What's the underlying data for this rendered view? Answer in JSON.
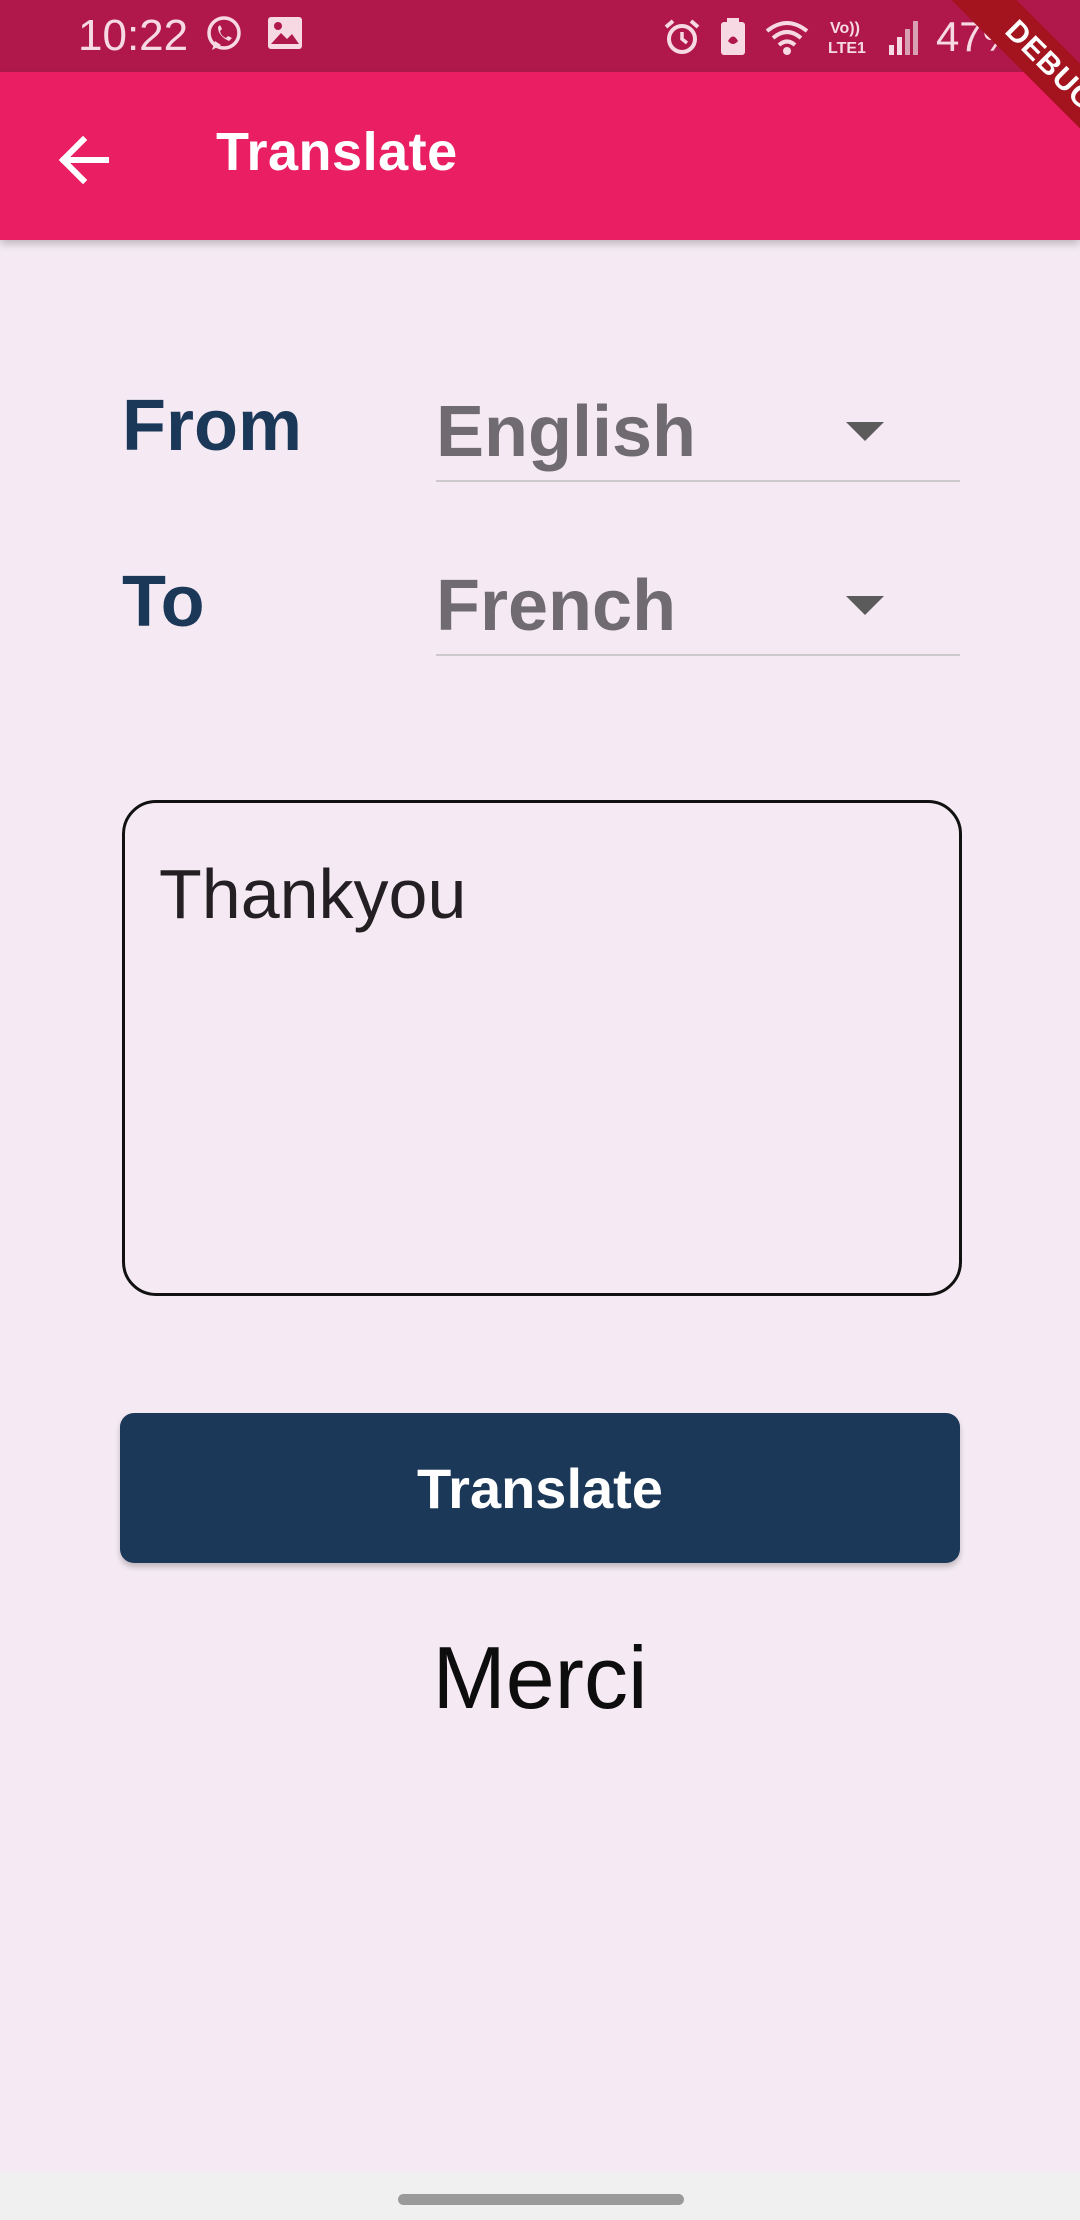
{
  "status_bar": {
    "time": "10:22",
    "left_icons": [
      "whatsapp-icon",
      "image-icon"
    ],
    "right_icons": [
      "alarm-icon",
      "battery-saver-icon",
      "wifi-icon",
      "volte-lte-icon",
      "signal-icon"
    ],
    "network_label": "Vo)) LTE1",
    "battery": "47%",
    "color": "#b0184b"
  },
  "app_bar": {
    "title": "Translate",
    "back_icon": "arrow-left-icon",
    "color": "#ea1f63"
  },
  "debug_banner": {
    "label": "DEBUG"
  },
  "form": {
    "from_label": "From",
    "to_label": "To",
    "from_language": "English",
    "to_language": "French",
    "input_text": "Thankyou"
  },
  "translate_button": {
    "label": "Translate",
    "color": "#1c3859"
  },
  "result": {
    "text": "Merci"
  },
  "colors": {
    "background": "#f5eaf3",
    "label": "#1c3859",
    "dropdown_text": "#706b70"
  }
}
